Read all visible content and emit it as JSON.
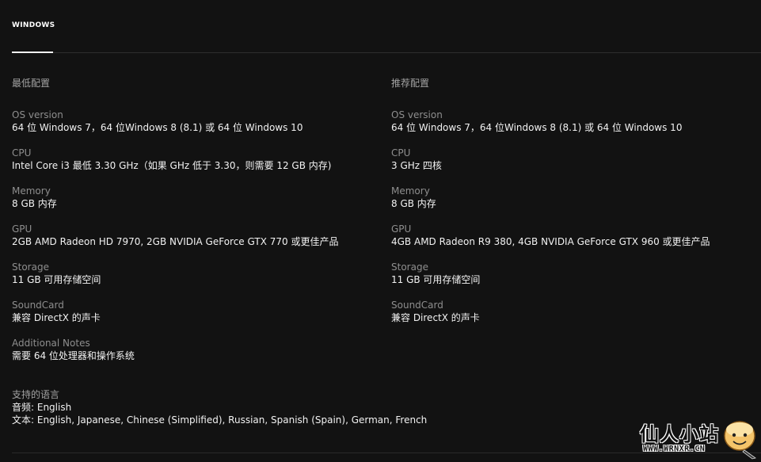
{
  "tabs": [
    {
      "label": "WINDOWS",
      "active": true
    }
  ],
  "minimum": {
    "heading": "最低配置",
    "specs": [
      {
        "label": "OS version",
        "value": "64 位 Windows 7，64 位Windows 8 (8.1) 或 64 位 Windows 10"
      },
      {
        "label": "CPU",
        "value": "Intel Core i3 最低 3.30 GHz（如果 GHz 低于 3.30，则需要 12 GB 内存)"
      },
      {
        "label": "Memory",
        "value": "8 GB 内存"
      },
      {
        "label": "GPU",
        "value": "2GB AMD Radeon HD 7970, 2GB NVIDIA GeForce GTX 770 或更佳产品"
      },
      {
        "label": "Storage",
        "value": "11 GB 可用存储空间"
      },
      {
        "label": "SoundCard",
        "value": "兼容 DirectX 的声卡"
      },
      {
        "label": "Additional Notes",
        "value": "需要 64 位处理器和操作系统"
      }
    ]
  },
  "recommended": {
    "heading": "推荐配置",
    "specs": [
      {
        "label": "OS version",
        "value": "64 位 Windows 7，64 位Windows 8 (8.1) 或 64 位 Windows 10"
      },
      {
        "label": "CPU",
        "value": "3 GHz 四核"
      },
      {
        "label": "Memory",
        "value": "8 GB 内存"
      },
      {
        "label": "GPU",
        "value": "4GB AMD Radeon R9 380, 4GB NVIDIA GeForce GTX 960 或更佳产品"
      },
      {
        "label": "Storage",
        "value": "11 GB 可用存储空间"
      },
      {
        "label": "SoundCard",
        "value": "兼容 DirectX 的声卡"
      }
    ]
  },
  "languages": {
    "heading": "支持的语言",
    "audio": "音频: English",
    "text": "文本: English, Japanese, Chinese (Simplified), Russian, Spanish (Spain), German, French"
  },
  "watermark": {
    "text": "仙人小站",
    "url": "WWW.WRNXR.CN"
  },
  "colors": {
    "background": "#121212",
    "label": "#8e8e8e",
    "value": "#f2f2f2"
  }
}
